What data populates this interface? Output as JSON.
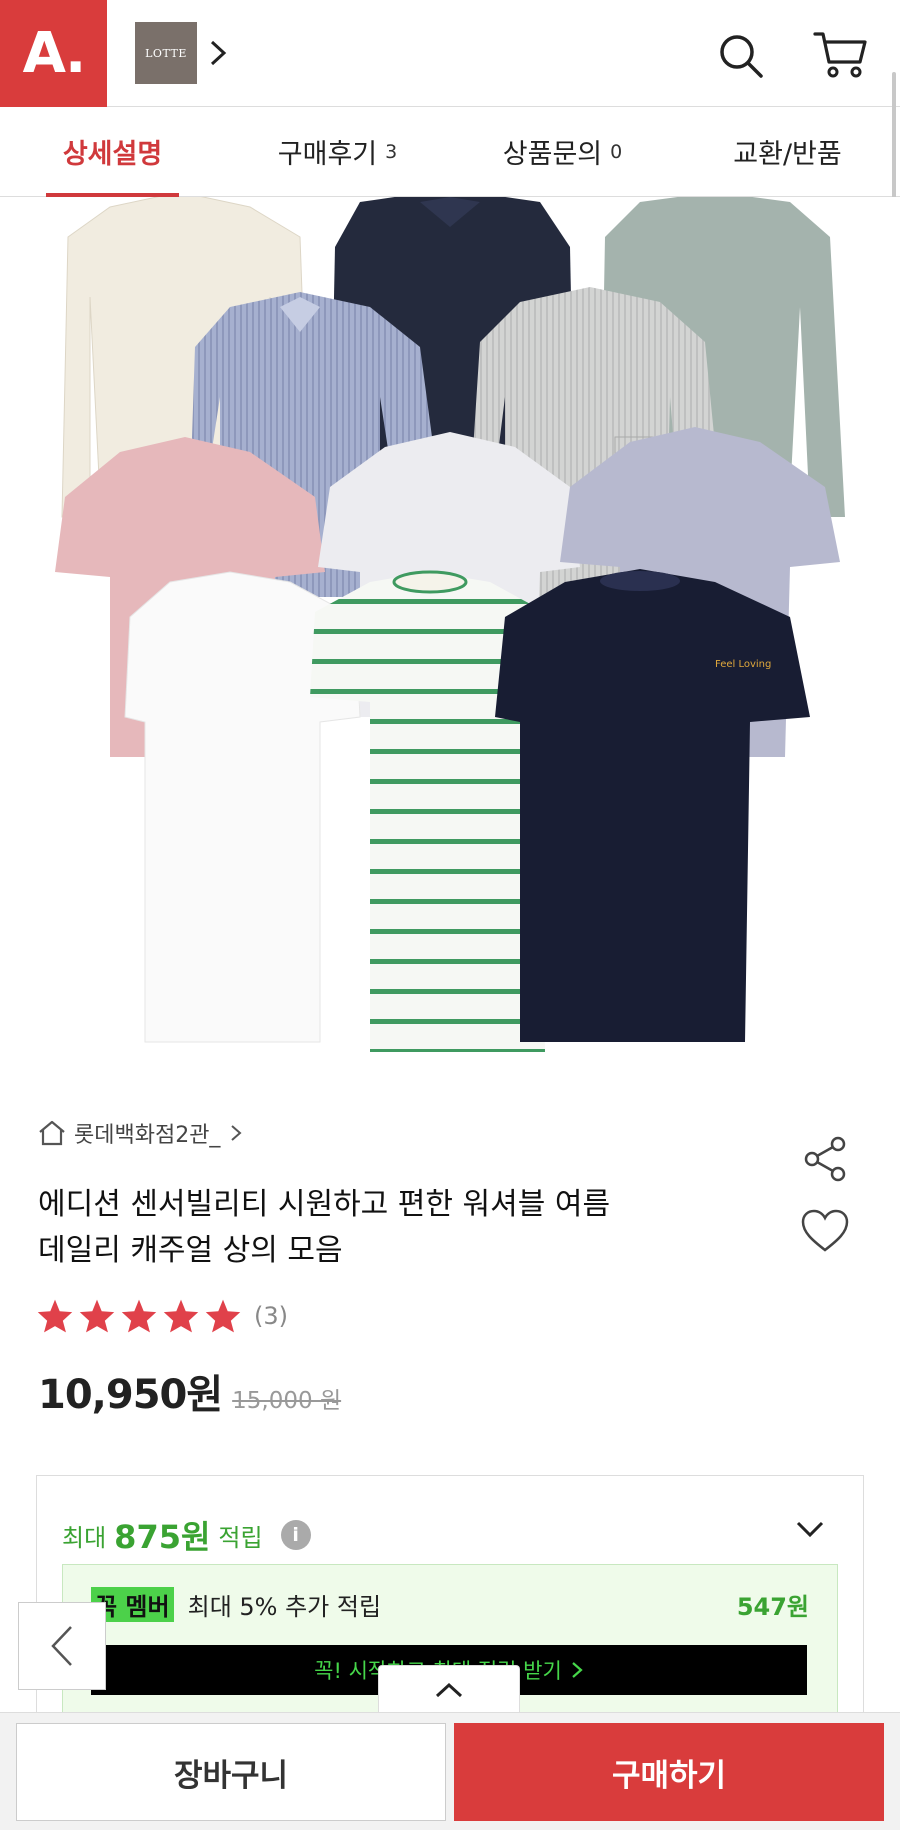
{
  "header": {
    "logo_text": "A.",
    "brand_badge": "LOTTE",
    "icons": [
      "search-icon",
      "cart-icon"
    ]
  },
  "tabs": [
    {
      "label": "상세설명",
      "count": "",
      "active": true
    },
    {
      "label": "구매후기",
      "count": "3",
      "active": false
    },
    {
      "label": "상품문의",
      "count": "0",
      "active": false
    },
    {
      "label": "교환/반품",
      "count": "",
      "active": false
    }
  ],
  "product": {
    "seller": "롯데백화점2관_",
    "title_line1": "에디션 센서빌리티 시원하고 편한 워셔블 여름",
    "title_line2": "데일리 캐주얼 상의 모음",
    "rating_stars": 5,
    "rating_count": "(3)",
    "price": "10,950원",
    "original_price": "15,000 원",
    "image_shirt_print": "Feel Loving"
  },
  "points": {
    "prefix": "최대",
    "amount": "875원",
    "suffix": "적립",
    "member_badge": "꼭 멤버",
    "member_text": "최대 5% 추가 적립",
    "member_amount": "547원",
    "member_cta": "꼭! 시작하고 최대 적립 받기"
  },
  "bottom": {
    "cart_label": "장바구니",
    "buy_label": "구매하기"
  },
  "colors": {
    "brand_red": "#d93c3c",
    "tab_active": "#d0393c",
    "points_green": "#3aa332",
    "member_green": "#4cd14a",
    "star_red": "#e0414a"
  }
}
